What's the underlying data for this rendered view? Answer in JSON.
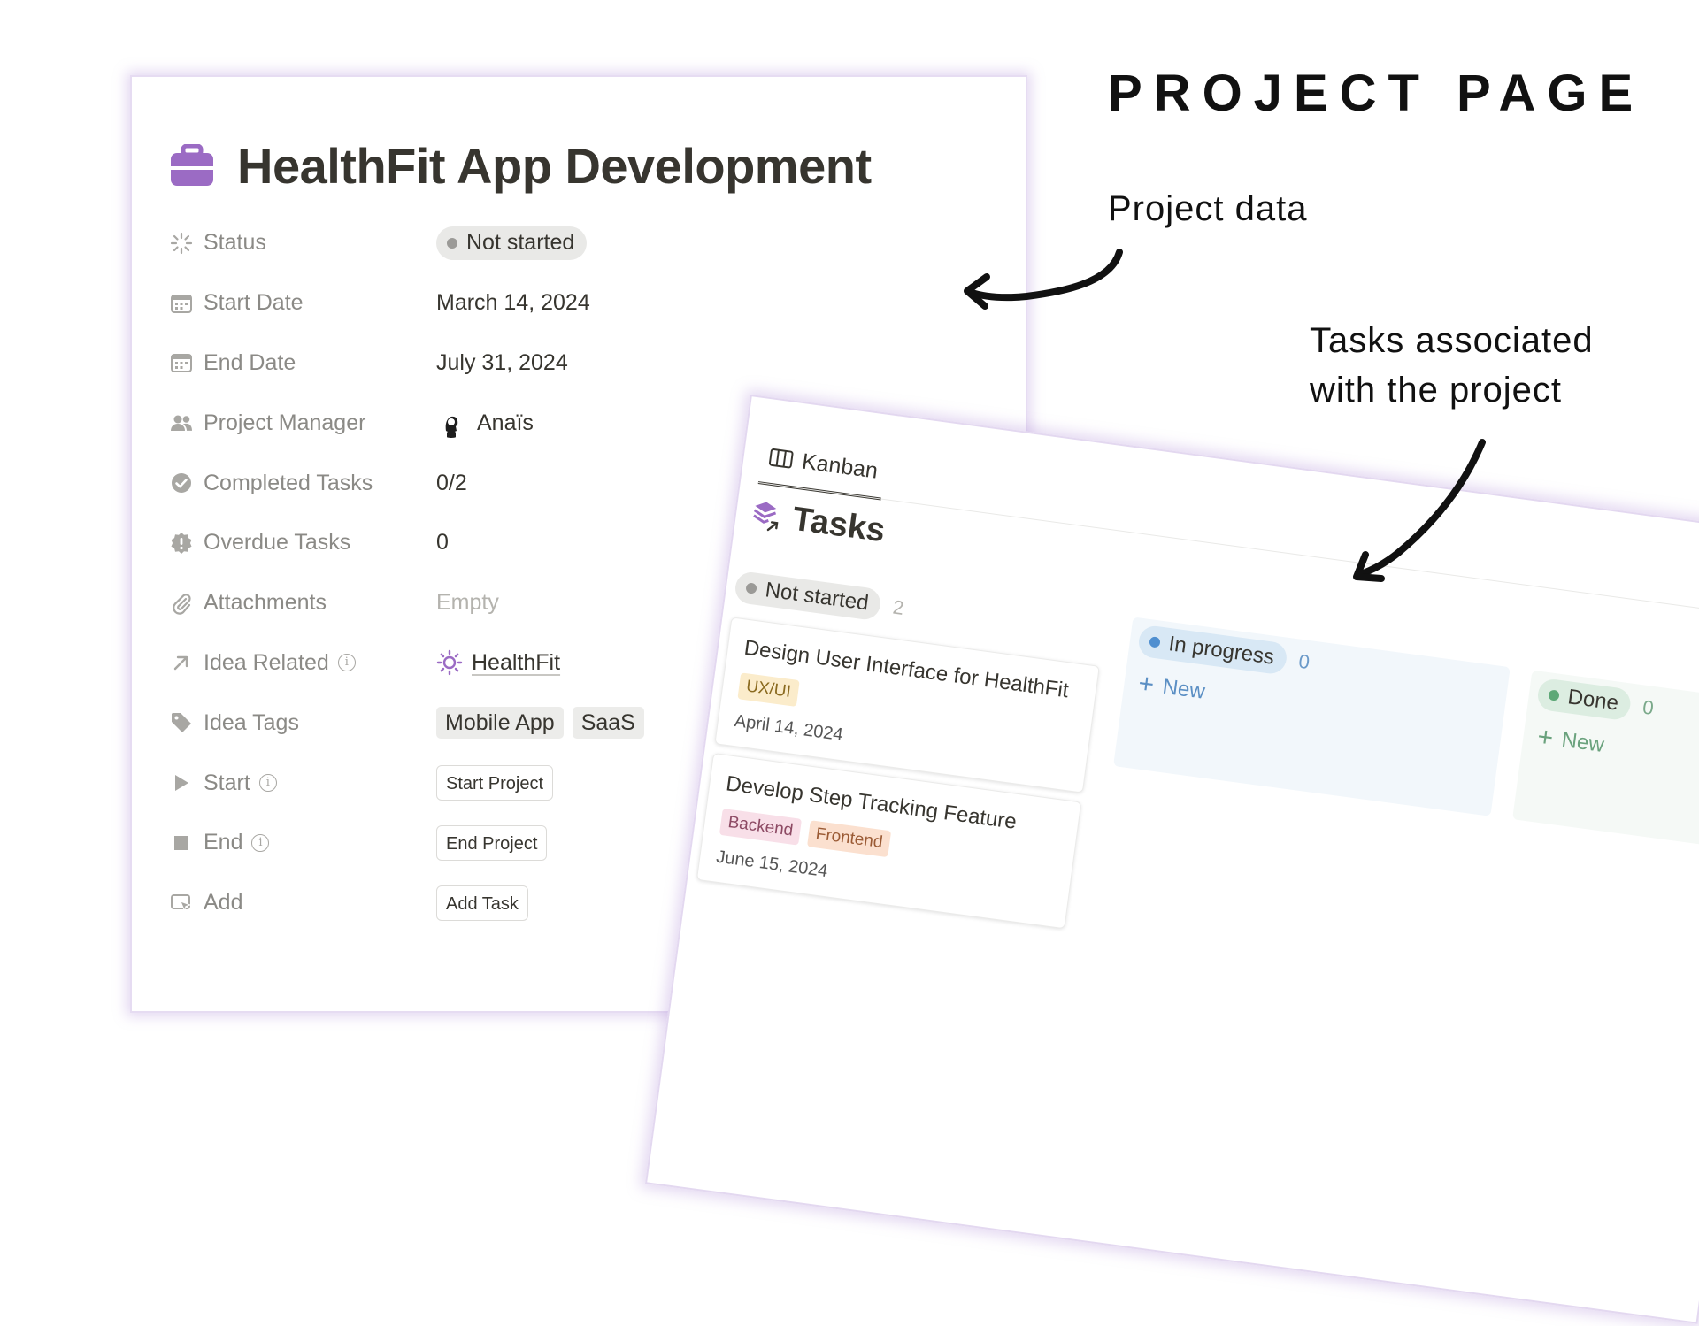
{
  "headline": "PROJECT PAGE",
  "annotations": {
    "project_data": "Project data",
    "tasks_line1": "Tasks associated",
    "tasks_line2": "with the project"
  },
  "page": {
    "title": "HealthFit App Development",
    "icon": "briefcase-icon",
    "accent_color": "#9b6bc4",
    "properties": {
      "status": {
        "label": "Status",
        "value": "Not started",
        "icon": "status-spinner-icon"
      },
      "start_date": {
        "label": "Start Date",
        "value": "March 14, 2024",
        "icon": "calendar-icon"
      },
      "end_date": {
        "label": "End Date",
        "value": "July 31, 2024",
        "icon": "calendar-icon"
      },
      "project_manager": {
        "label": "Project Manager",
        "value": "Anaïs",
        "icon": "people-icon"
      },
      "completed_tasks": {
        "label": "Completed Tasks",
        "value": "0/2",
        "icon": "check-circle-icon"
      },
      "overdue_tasks": {
        "label": "Overdue Tasks",
        "value": "0",
        "icon": "alert-badge-icon"
      },
      "attachments": {
        "label": "Attachments",
        "value": "Empty",
        "icon": "paperclip-icon"
      },
      "idea_related": {
        "label": "Idea Related",
        "value": "HealthFit",
        "icon": "arrow-up-right-icon"
      },
      "idea_tags": {
        "label": "Idea Tags",
        "values": [
          "Mobile App",
          "SaaS"
        ],
        "icon": "tag-icon"
      },
      "start": {
        "label": "Start",
        "button": "Start Project",
        "icon": "play-icon"
      },
      "end": {
        "label": "End",
        "button": "End Project",
        "icon": "stop-icon"
      },
      "add": {
        "label": "Add",
        "button": "Add Task",
        "icon": "cursor-click-icon"
      }
    }
  },
  "kanban": {
    "view_tab": "Kanban",
    "title": "Tasks",
    "columns": [
      {
        "name": "Not started",
        "count": "2",
        "dot_color": "#9b9a97",
        "pill_bg": "#e9e9e7",
        "cards": [
          {
            "title": "Design User Interface for HealthFit",
            "tags": [
              "UX/UI"
            ],
            "date": "April 14, 2024"
          },
          {
            "title": "Develop Step Tracking Feature",
            "tags": [
              "Backend",
              "Frontend"
            ],
            "date": "June 15, 2024"
          }
        ]
      },
      {
        "name": "In progress",
        "count": "0",
        "dot_color": "#4f8fd0",
        "pill_bg": "#d8e8f5",
        "new_label": "New"
      },
      {
        "name": "Done",
        "count": "0",
        "dot_color": "#5ea877",
        "pill_bg": "#dcede1",
        "new_label": "New"
      }
    ],
    "tag_colors": {
      "UX/UI": {
        "bg": "#fbeccb",
        "fg": "#8a6a1f"
      },
      "Backend": {
        "bg": "#f8dfe8",
        "fg": "#8d4a64"
      },
      "Frontend": {
        "bg": "#fbe0cf",
        "fg": "#9a5a34"
      }
    }
  }
}
